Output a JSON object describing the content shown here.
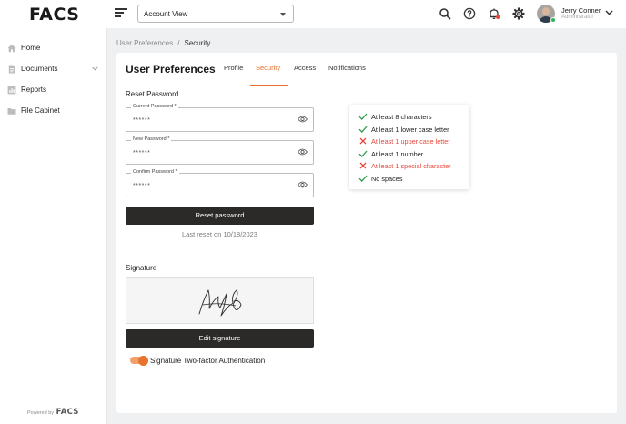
{
  "header": {
    "logo": "FACS",
    "view_select": {
      "value": "Account View"
    },
    "user": {
      "name": "Jerry Conner",
      "role": "Administrator"
    }
  },
  "sidebar": {
    "items": [
      {
        "label": "Home",
        "icon": "home-icon"
      },
      {
        "label": "Documents",
        "icon": "document-icon"
      },
      {
        "label": "Reports",
        "icon": "chart-icon"
      },
      {
        "label": "File Cabinet",
        "icon": "folder-icon"
      }
    ],
    "powered_prefix": "Powered by",
    "powered_logo": "FACS"
  },
  "breadcrumb": {
    "parent": "User Preferences",
    "separator": "/",
    "current": "Security"
  },
  "page": {
    "title": "User Preferences",
    "tabs": [
      {
        "label": "Profile"
      },
      {
        "label": "Security"
      },
      {
        "label": "Access"
      },
      {
        "label": "Notifications"
      }
    ],
    "active_tab": "Security"
  },
  "reset": {
    "section_label": "Reset Password",
    "fields": [
      {
        "label": "Current Password *",
        "value": "******"
      },
      {
        "label": "New Password *",
        "value": "******"
      },
      {
        "label": "Confirm Password *",
        "value": "******"
      }
    ],
    "button_label": "Reset password",
    "last_reset": "Last reset on 10/18/2023"
  },
  "requirements": [
    {
      "text": "At least 8 characters",
      "met": true
    },
    {
      "text": "At least 1 lower case letter",
      "met": true
    },
    {
      "text": "At least 1 upper case letter",
      "met": false
    },
    {
      "text": "At least 1 number",
      "met": true
    },
    {
      "text": "At least 1 special character",
      "met": false
    },
    {
      "text": "No spaces",
      "met": true
    }
  ],
  "signature": {
    "section_label": "Signature",
    "edit_button_label": "Edit signature",
    "two_factor_label": "Signature Two-factor Authentication",
    "two_factor_enabled": true
  },
  "colors": {
    "accent": "#e8722e",
    "error": "#e5483b",
    "success": "#2e9a4a",
    "dark_button": "#2c2a28"
  }
}
